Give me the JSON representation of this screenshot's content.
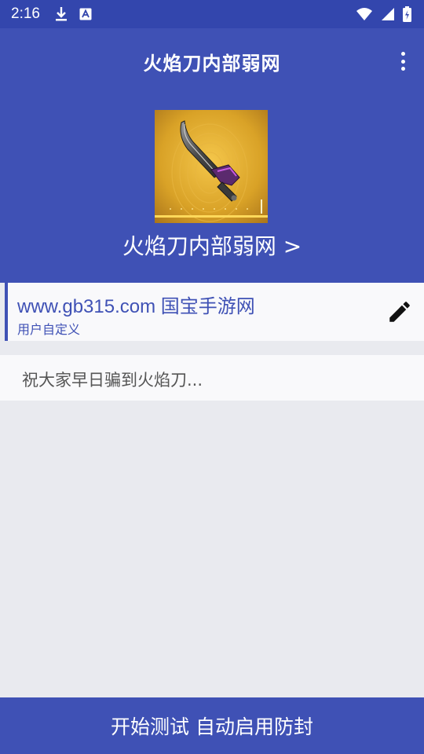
{
  "status_bar": {
    "time": "2:16",
    "icons": [
      "download-icon",
      "font-icon",
      "wifi-icon",
      "signal-icon",
      "battery-icon"
    ]
  },
  "app_bar": {
    "title": "火焰刀内部弱网",
    "menu_icon": "more-vert-icon"
  },
  "header": {
    "game_name": "火焰刀内部弱网 >",
    "thumbnail_icon": "flame-blade-weapon-image"
  },
  "selected_item": {
    "title": "www.gb315.com 国宝手游网",
    "subtitle": "用户自定义",
    "edit_icon": "edit-pencil-icon"
  },
  "note": {
    "text": "祝大家早日骗到火焰刀..."
  },
  "bottom_button": {
    "label": "开始测试 自动启用防封"
  },
  "colors": {
    "primary": "#3f51b5",
    "primary_dark": "#3346ad",
    "background": "#e9eaef",
    "card": "#f9f9fb",
    "accent_gold": "#d9a227"
  }
}
